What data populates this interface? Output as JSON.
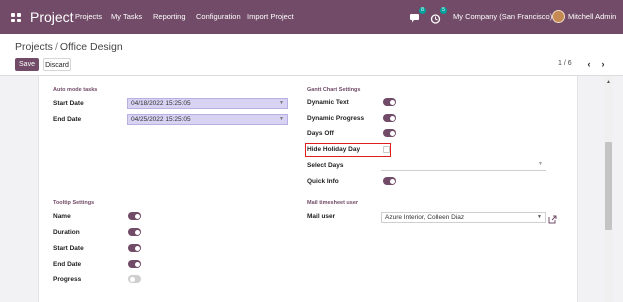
{
  "navbar": {
    "brand": "Project",
    "menu": [
      "Projects",
      "My Tasks",
      "Reporting",
      "Configuration",
      "Import Project"
    ],
    "chat_badge": "8",
    "activity_badge": "5",
    "company": "My Company (San Francisco)",
    "user": "Mitchell Admin"
  },
  "breadcrumb": {
    "parent": "Projects",
    "separator": "/",
    "current": "Office Design"
  },
  "buttons": {
    "save": "Save",
    "discard": "Discard"
  },
  "pager": {
    "value": "1 / 6",
    "prev": "‹",
    "next": "›"
  },
  "auto_mode": {
    "title": "Auto mode tasks",
    "start_label": "Start Date",
    "start_value": "04/18/2022 15:25:05",
    "end_label": "End Date",
    "end_value": "04/25/2022 15:25:05"
  },
  "gantt": {
    "title": "Gantt Chart Settings",
    "dynamic_text": "Dynamic Text",
    "dynamic_progress": "Dynamic Progress",
    "days_off": "Days Off",
    "hide_holiday": "Hide Holiday Day",
    "select_days": "Select Days",
    "quick_info": "Quick Info"
  },
  "tooltip": {
    "title": "Tooltip Settings",
    "name": "Name",
    "duration": "Duration",
    "start_date": "Start Date",
    "end_date": "End Date",
    "progress": "Progress"
  },
  "mail": {
    "title": "Mail timesheet user",
    "label": "Mail user",
    "value": "Azure Interior, Colleen Diaz"
  },
  "colors": {
    "brand": "#714b67",
    "date_field_bg": "#d8d3f3",
    "highlight": "#e01e1e"
  }
}
